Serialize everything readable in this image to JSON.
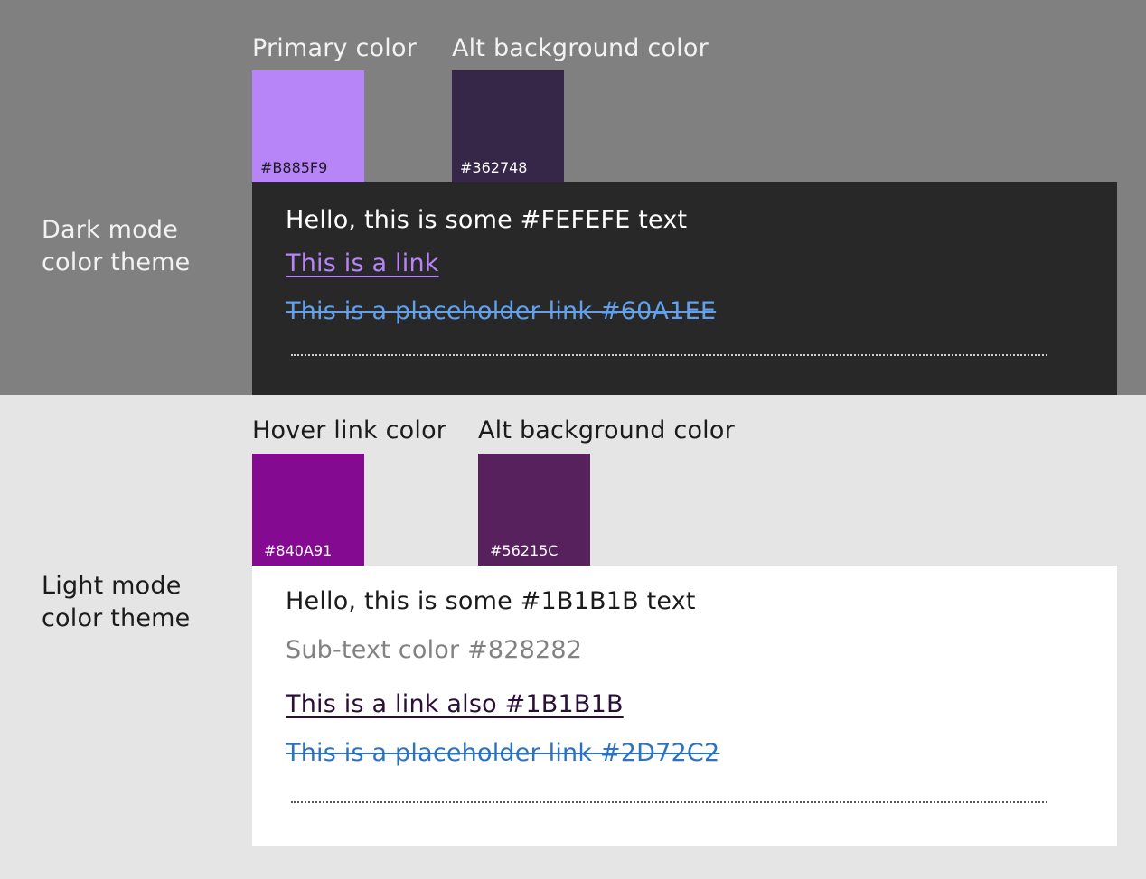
{
  "dark": {
    "theme_label": [
      "Dark mode",
      "color theme"
    ],
    "swatches": [
      {
        "title": "Primary color",
        "hex": "#B885F9",
        "color": "#B885F9",
        "hex_text_color": "#1B1B1B"
      },
      {
        "title": "Alt background color",
        "hex": "#362748",
        "color": "#362748",
        "hex_text_color": "#FEFEFE"
      }
    ],
    "panel": {
      "background": "#282828",
      "text": "Hello, this is some #FEFEFE text",
      "link": "This is a link",
      "placeholder_link": "This is a placeholder link #60A1EE"
    }
  },
  "light": {
    "theme_label": [
      "Light mode",
      "color theme"
    ],
    "swatches": [
      {
        "title": "Hover link color",
        "hex": "#840A91",
        "color": "#840A91",
        "hex_text_color": "#FEFEFE"
      },
      {
        "title": "Alt background color",
        "hex": "#56215C",
        "color": "#56215C",
        "hex_text_color": "#FEFEFE"
      }
    ],
    "panel": {
      "background": "#FFFFFF",
      "text": "Hello, this is some #1B1B1B text",
      "subtext": "Sub-text color #828282",
      "link": "This is a link also #1B1B1B",
      "placeholder_link": "This is a placeholder link #2D72C2"
    }
  },
  "colors": {
    "dark_text": "#FEFEFE",
    "dark_link": "#B885F9",
    "dark_placeholder": "#60A1EE",
    "light_text": "#1B1B1B",
    "light_subtext": "#828282",
    "light_link": "#2A0F36",
    "light_placeholder": "#2D72C2"
  }
}
